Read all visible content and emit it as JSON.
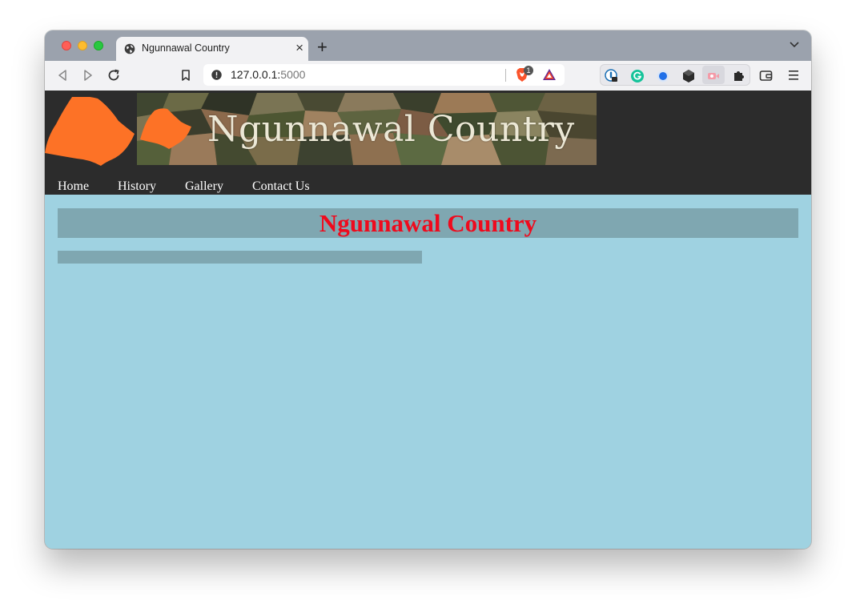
{
  "browser": {
    "tab_title": "Ngunnawal Country",
    "tab_close": "×",
    "new_tab": "+",
    "url_host": "127.0.0.1:",
    "url_port": "5000",
    "brave_badge": "1"
  },
  "page": {
    "banner_title": "Ngunnawal Country",
    "nav": [
      "Home",
      "History",
      "Gallery",
      "Contact Us"
    ],
    "heading": "Ngunnawal Country"
  },
  "colors": {
    "page_bg": "#9fd2e1",
    "header_bg": "#2c2c2c",
    "heading_text": "#ef0a1d",
    "content_box": "#7fa7b1",
    "logo_orange": "#fd7226"
  },
  "icons": {
    "tab": "globe-icon",
    "toolbar": [
      "back-icon",
      "forward-icon",
      "reload-icon",
      "bookmark-icon",
      "site-info-icon",
      "brave-shields-icon",
      "brave-rewards-icon",
      "wallet-icon",
      "menu-icon"
    ],
    "extensions": [
      "password-manager-icon",
      "grammarly-icon",
      "blue-dot-extension-icon",
      "cube-extension-icon",
      "video-extension-icon",
      "extensions-puzzle-icon"
    ]
  }
}
